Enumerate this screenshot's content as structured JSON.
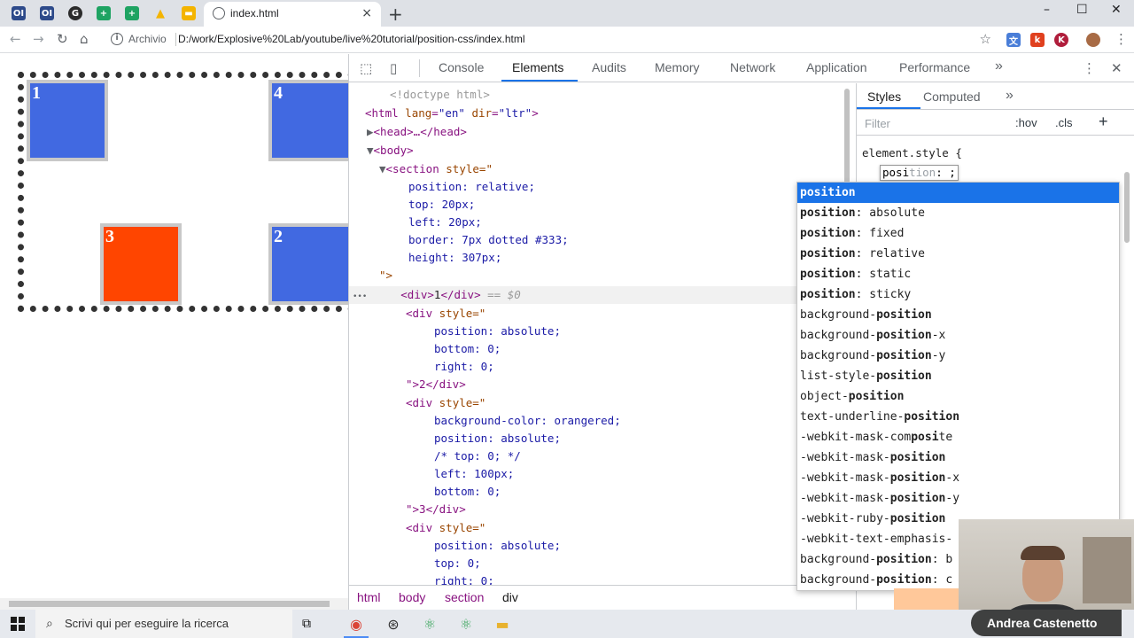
{
  "browser": {
    "pinned_tabs": [
      {
        "icon": "onenote-icon",
        "glyph": "OI",
        "color": "#2d4a8a"
      },
      {
        "icon": "onenote-icon",
        "glyph": "OI",
        "color": "#2d4a8a"
      },
      {
        "icon": "grammarly-icon",
        "glyph": "G",
        "color": "#2b2b2b"
      },
      {
        "icon": "google-sheets-icon",
        "glyph": "+",
        "color": "#1ea362"
      },
      {
        "icon": "google-sheets-icon",
        "glyph": "+",
        "color": "#1ea362"
      },
      {
        "icon": "google-drive-icon",
        "glyph": "▲",
        "color": "#f4b400"
      },
      {
        "icon": "google-slides-icon",
        "glyph": "▬",
        "color": "#f4b400"
      }
    ],
    "active_tab": {
      "title": "index.html",
      "close": "×"
    },
    "new_tab": "+",
    "window_controls": {
      "minimize": "–",
      "maximize": "☐",
      "close": "✕"
    },
    "address": {
      "scheme_label": "Archivio",
      "url": "D:/work/Explosive%20Lab/youtube/live%20tutorial/position-css/index.html"
    },
    "extensions": [
      {
        "icon": "translate-icon",
        "glyph": "文",
        "color": "#4a7ed8"
      },
      {
        "icon": "k-extension-icon",
        "glyph": "k",
        "color": "#e0401e"
      },
      {
        "icon": "k-circle-extension-icon",
        "glyph": "K",
        "color": "#b01e3c"
      }
    ]
  },
  "page": {
    "boxes": [
      {
        "label": "1",
        "color": "#4169e1"
      },
      {
        "label": "4",
        "color": "#4169e1"
      },
      {
        "label": "3",
        "color": "#ff4500"
      },
      {
        "label": "2",
        "color": "#4169e1"
      }
    ]
  },
  "devtools": {
    "tabs": [
      "Console",
      "Elements",
      "Audits",
      "Memory",
      "Network",
      "Application",
      "Performance"
    ],
    "active_tab": "Elements",
    "more_tabs": "»",
    "kebab": "⋮",
    "close": "✕",
    "dom": {
      "doctype": "<!doctype html>",
      "html_open": "<html",
      "html_attr1_name": "lang",
      "html_attr1_val": "\"en\"",
      "html_attr2_name": "dir",
      "html_attr2_val": "\"ltr\"",
      "head": "<head>…</head>",
      "body_open": "<body>",
      "section_open": "<section",
      "style_attr": "style",
      "quote_open": "=\"",
      "section_css": [
        "position: relative;",
        "top: 20px;",
        "left: 20px;",
        "border: 7px dotted #333;",
        "height: 307px;"
      ],
      "quote_close": "\">",
      "selected_div": {
        "open": "<div>",
        "text": "1",
        "close": "</div>",
        "suffix": " == $0"
      },
      "div_open": "<div",
      "div2_css": [
        "position: absolute;",
        "bottom: 0;",
        "right: 0;"
      ],
      "div2_close": "\">2</div>",
      "div3_css": [
        "background-color: orangered;",
        "position: absolute;",
        "/* top: 0; */",
        "left: 100px;",
        "bottom: 0;"
      ],
      "div3_close": "\">3</div>",
      "div4_css": [
        "position: absolute;",
        "top: 0;",
        "right: 0;"
      ],
      "ellipsis": "•••"
    },
    "breadcrumbs": [
      "html",
      "body",
      "section",
      "div"
    ],
    "styles": {
      "tabs": [
        "Styles",
        "Computed"
      ],
      "more": "»",
      "filter_placeholder": "Filter",
      "hov": ":hov",
      "cls": ".cls",
      "plus": "+",
      "rule_selector": "element.style {",
      "input_typed": "posi",
      "input_hint": "tion",
      "input_suffix": ": ;"
    },
    "autocomplete": [
      {
        "pre": "",
        "match": "position",
        "post": "",
        "selected": true
      },
      {
        "pre": "",
        "match": "position",
        "post": ": absolute"
      },
      {
        "pre": "",
        "match": "position",
        "post": ": fixed"
      },
      {
        "pre": "",
        "match": "position",
        "post": ": relative"
      },
      {
        "pre": "",
        "match": "position",
        "post": ": static"
      },
      {
        "pre": "",
        "match": "position",
        "post": ": sticky"
      },
      {
        "pre": "background-",
        "match": "position",
        "post": ""
      },
      {
        "pre": "background-",
        "match": "position",
        "post": "-x"
      },
      {
        "pre": "background-",
        "match": "position",
        "post": "-y"
      },
      {
        "pre": "list-style-",
        "match": "position",
        "post": ""
      },
      {
        "pre": "object-",
        "match": "position",
        "post": ""
      },
      {
        "pre": "text-underline-",
        "match": "position",
        "post": ""
      },
      {
        "pre": "-webkit-mask-com",
        "match": "posi",
        "post": "te"
      },
      {
        "pre": "-webkit-mask-",
        "match": "position",
        "post": ""
      },
      {
        "pre": "-webkit-mask-",
        "match": "position",
        "post": "-x"
      },
      {
        "pre": "-webkit-mask-",
        "match": "position",
        "post": "-y"
      },
      {
        "pre": "-webkit-ruby-",
        "match": "position",
        "post": ""
      },
      {
        "pre": "-webkit-text-emphasis-",
        "match": "",
        "post": ""
      },
      {
        "pre": "background-",
        "match": "position",
        "post": ": b"
      },
      {
        "pre": "background-",
        "match": "position",
        "post": ": c"
      }
    ]
  },
  "webcam": {
    "name": "Andrea Castenetto"
  },
  "taskbar": {
    "search_placeholder": "Scrivi qui per eseguire la ricerca",
    "apps": [
      {
        "icon": "task-view-icon",
        "glyph": "⧉"
      },
      {
        "icon": "chrome-icon",
        "glyph": "◉"
      },
      {
        "icon": "steam-icon",
        "glyph": "⊛"
      },
      {
        "icon": "atom-icon",
        "glyph": "⚛"
      },
      {
        "icon": "atom-beta-icon",
        "glyph": "⚛"
      },
      {
        "icon": "file-explorer-icon",
        "glyph": "▬"
      }
    ]
  }
}
